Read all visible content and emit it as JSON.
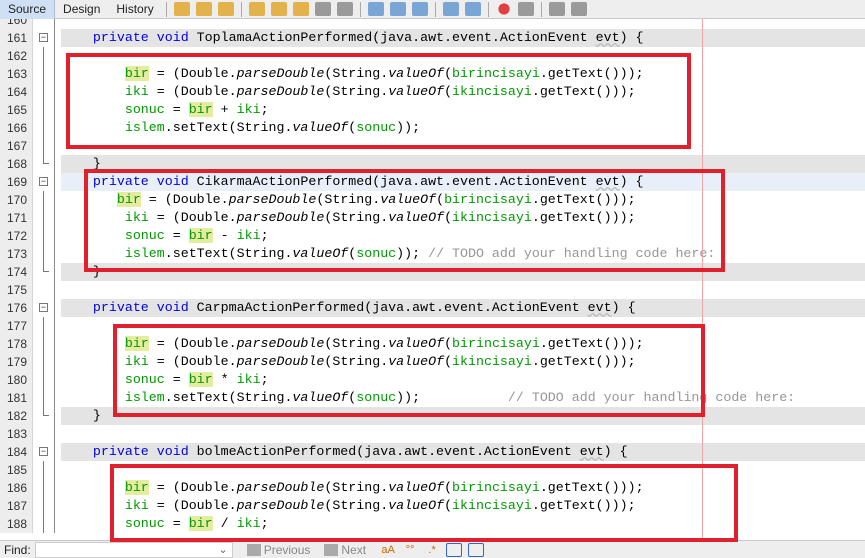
{
  "toolbar": {
    "tabs": [
      "Source",
      "Design",
      "History"
    ],
    "active": "Source",
    "icons": [
      "last-edit-icon",
      "back-icon",
      "forward-icon",
      "find-selection-icon",
      "find-previous-icon",
      "find-next-icon",
      "toggle-highlight-icon",
      "rectangular-select-icon",
      "previous-bookmark-icon",
      "next-bookmark-icon",
      "toggle-bookmark-icon",
      "shift-left-icon",
      "shift-right-icon",
      "record-macro-icon",
      "stop-macro-icon",
      "comment-icon",
      "uncomment-icon"
    ]
  },
  "editor": {
    "lines": [
      {
        "n": "160",
        "segs": []
      },
      {
        "n": "161",
        "fold": "box",
        "gray": true,
        "segs": [
          [
            "    ",
            ""
          ],
          [
            "private void",
            "kw"
          ],
          [
            " ToplamaActionPerformed(java.awt.event.ActionEvent ",
            ""
          ],
          [
            "evt",
            "ul"
          ],
          [
            ") {",
            ""
          ]
        ]
      },
      {
        "n": "162",
        "fold": "line",
        "segs": []
      },
      {
        "n": "163",
        "fold": "line",
        "segs": [
          [
            "        ",
            ""
          ],
          [
            "bir",
            "hl"
          ],
          [
            " = (Double.",
            ""
          ],
          [
            "parseDouble",
            "it"
          ],
          [
            "(String.",
            ""
          ],
          [
            "valueOf",
            "it"
          ],
          [
            "(",
            ""
          ],
          [
            "birincisayi",
            "fd"
          ],
          [
            ".getText()));",
            ""
          ]
        ]
      },
      {
        "n": "164",
        "fold": "line",
        "segs": [
          [
            "        ",
            ""
          ],
          [
            "iki",
            "fd"
          ],
          [
            " = (Double.",
            ""
          ],
          [
            "parseDouble",
            "it"
          ],
          [
            "(String.",
            ""
          ],
          [
            "valueOf",
            "it"
          ],
          [
            "(",
            ""
          ],
          [
            "ikincisayi",
            "fd"
          ],
          [
            ".getText()));",
            ""
          ]
        ]
      },
      {
        "n": "165",
        "fold": "line",
        "segs": [
          [
            "        ",
            ""
          ],
          [
            "sonuc",
            "fd"
          ],
          [
            " = ",
            ""
          ],
          [
            "bir",
            "hl"
          ],
          [
            " + ",
            ""
          ],
          [
            "iki",
            "fd"
          ],
          [
            ";",
            ""
          ]
        ]
      },
      {
        "n": "166",
        "fold": "line",
        "segs": [
          [
            "        ",
            ""
          ],
          [
            "islem",
            "fd"
          ],
          [
            ".setText(String.",
            ""
          ],
          [
            "valueOf",
            "it"
          ],
          [
            "(",
            ""
          ],
          [
            "sonuc",
            "fd"
          ],
          [
            "));",
            ""
          ]
        ]
      },
      {
        "n": "167",
        "fold": "line",
        "segs": []
      },
      {
        "n": "168",
        "fold": "end",
        "gray": true,
        "segs": [
          [
            "    }",
            ""
          ]
        ]
      },
      {
        "n": "169",
        "fold": "box",
        "cur": true,
        "segs": [
          [
            "    ",
            ""
          ],
          [
            "private void",
            "kw"
          ],
          [
            " CikarmaActionPerformed(java.awt.event.ActionEvent ",
            ""
          ],
          [
            "evt",
            "ul"
          ],
          [
            ") {",
            ""
          ]
        ]
      },
      {
        "n": "170",
        "fold": "line",
        "segs": [
          [
            "       ",
            ""
          ],
          [
            "bir",
            "hl"
          ],
          [
            " = (Double.",
            ""
          ],
          [
            "parseDouble",
            "it"
          ],
          [
            "(String.",
            ""
          ],
          [
            "valueOf",
            "it"
          ],
          [
            "(",
            ""
          ],
          [
            "birincisayi",
            "fd"
          ],
          [
            ".getText()));",
            ""
          ]
        ]
      },
      {
        "n": "171",
        "fold": "line",
        "segs": [
          [
            "        ",
            ""
          ],
          [
            "iki",
            "fd"
          ],
          [
            " = (Double.",
            ""
          ],
          [
            "parseDouble",
            "it"
          ],
          [
            "(String.",
            ""
          ],
          [
            "valueOf",
            "it"
          ],
          [
            "(",
            ""
          ],
          [
            "ikincisayi",
            "fd"
          ],
          [
            ".getText()));",
            ""
          ]
        ]
      },
      {
        "n": "172",
        "fold": "line",
        "segs": [
          [
            "        ",
            ""
          ],
          [
            "sonuc",
            "fd"
          ],
          [
            " = ",
            ""
          ],
          [
            "bir",
            "hl"
          ],
          [
            " - ",
            ""
          ],
          [
            "iki",
            "fd"
          ],
          [
            ";",
            ""
          ]
        ]
      },
      {
        "n": "173",
        "fold": "line",
        "segs": [
          [
            "        ",
            ""
          ],
          [
            "islem",
            "fd"
          ],
          [
            ".setText(String.",
            ""
          ],
          [
            "valueOf",
            "it"
          ],
          [
            "(",
            ""
          ],
          [
            "sonuc",
            "fd"
          ],
          [
            ")); ",
            ""
          ],
          [
            "// TODO add your handling code here:",
            "cm"
          ]
        ]
      },
      {
        "n": "174",
        "fold": "end",
        "gray": true,
        "segs": [
          [
            "    }",
            ""
          ]
        ]
      },
      {
        "n": "175",
        "segs": []
      },
      {
        "n": "176",
        "fold": "box",
        "gray": true,
        "segs": [
          [
            "    ",
            ""
          ],
          [
            "private void",
            "kw"
          ],
          [
            " CarpmaActionPerformed(java.awt.event.ActionEvent ",
            ""
          ],
          [
            "evt",
            "ul"
          ],
          [
            ") {",
            ""
          ]
        ]
      },
      {
        "n": "177",
        "fold": "line",
        "segs": []
      },
      {
        "n": "178",
        "fold": "line",
        "segs": [
          [
            "        ",
            ""
          ],
          [
            "bir",
            "hl"
          ],
          [
            " = (Double.",
            ""
          ],
          [
            "parseDouble",
            "it"
          ],
          [
            "(String.",
            ""
          ],
          [
            "valueOf",
            "it"
          ],
          [
            "(",
            ""
          ],
          [
            "birincisayi",
            "fd"
          ],
          [
            ".getText()));",
            ""
          ]
        ]
      },
      {
        "n": "179",
        "fold": "line",
        "segs": [
          [
            "        ",
            ""
          ],
          [
            "iki",
            "fd"
          ],
          [
            " = (Double.",
            ""
          ],
          [
            "parseDouble",
            "it"
          ],
          [
            "(String.",
            ""
          ],
          [
            "valueOf",
            "it"
          ],
          [
            "(",
            ""
          ],
          [
            "ikincisayi",
            "fd"
          ],
          [
            ".getText()));",
            ""
          ]
        ]
      },
      {
        "n": "180",
        "fold": "line",
        "segs": [
          [
            "        ",
            ""
          ],
          [
            "sonuc",
            "fd"
          ],
          [
            " = ",
            ""
          ],
          [
            "bir",
            "hl"
          ],
          [
            " * ",
            ""
          ],
          [
            "iki",
            "fd"
          ],
          [
            ";",
            ""
          ]
        ]
      },
      {
        "n": "181",
        "fold": "line",
        "segs": [
          [
            "        ",
            ""
          ],
          [
            "islem",
            "fd"
          ],
          [
            ".setText(String.",
            ""
          ],
          [
            "valueOf",
            "it"
          ],
          [
            "(",
            ""
          ],
          [
            "sonuc",
            "fd"
          ],
          [
            "));",
            ""
          ],
          [
            "           // TODO add your handling code here:",
            "cm"
          ]
        ]
      },
      {
        "n": "182",
        "fold": "end",
        "gray": true,
        "segs": [
          [
            "    }",
            ""
          ]
        ]
      },
      {
        "n": "183",
        "segs": []
      },
      {
        "n": "184",
        "fold": "box",
        "gray": true,
        "segs": [
          [
            "    ",
            ""
          ],
          [
            "private void",
            "kw"
          ],
          [
            " bolmeActionPerformed(java.awt.event.ActionEvent ",
            ""
          ],
          [
            "evt",
            "ul"
          ],
          [
            ") {",
            ""
          ]
        ]
      },
      {
        "n": "185",
        "fold": "line",
        "segs": []
      },
      {
        "n": "186",
        "fold": "line",
        "segs": [
          [
            "        ",
            ""
          ],
          [
            "bir",
            "hl"
          ],
          [
            " = (Double.",
            ""
          ],
          [
            "parseDouble",
            "it"
          ],
          [
            "(String.",
            ""
          ],
          [
            "valueOf",
            "it"
          ],
          [
            "(",
            ""
          ],
          [
            "birincisayi",
            "fd"
          ],
          [
            ".getText()));",
            ""
          ]
        ]
      },
      {
        "n": "187",
        "fold": "line",
        "segs": [
          [
            "        ",
            ""
          ],
          [
            "iki",
            "fd"
          ],
          [
            " = (Double.",
            ""
          ],
          [
            "parseDouble",
            "it"
          ],
          [
            "(String.",
            ""
          ],
          [
            "valueOf",
            "it"
          ],
          [
            "(",
            ""
          ],
          [
            "ikincisayi",
            "fd"
          ],
          [
            ".getText()));",
            ""
          ]
        ]
      },
      {
        "n": "188",
        "fold": "line",
        "segs": [
          [
            "        ",
            ""
          ],
          [
            "sonuc",
            "fd"
          ],
          [
            " = ",
            ""
          ],
          [
            "bir",
            "hl"
          ],
          [
            " / ",
            ""
          ],
          [
            "iki",
            "fd"
          ],
          [
            ";",
            ""
          ]
        ]
      }
    ]
  },
  "annotation_color": "#e0202c",
  "findbar": {
    "label": "Find:",
    "value": "",
    "previous": "Previous",
    "next": "Next"
  }
}
